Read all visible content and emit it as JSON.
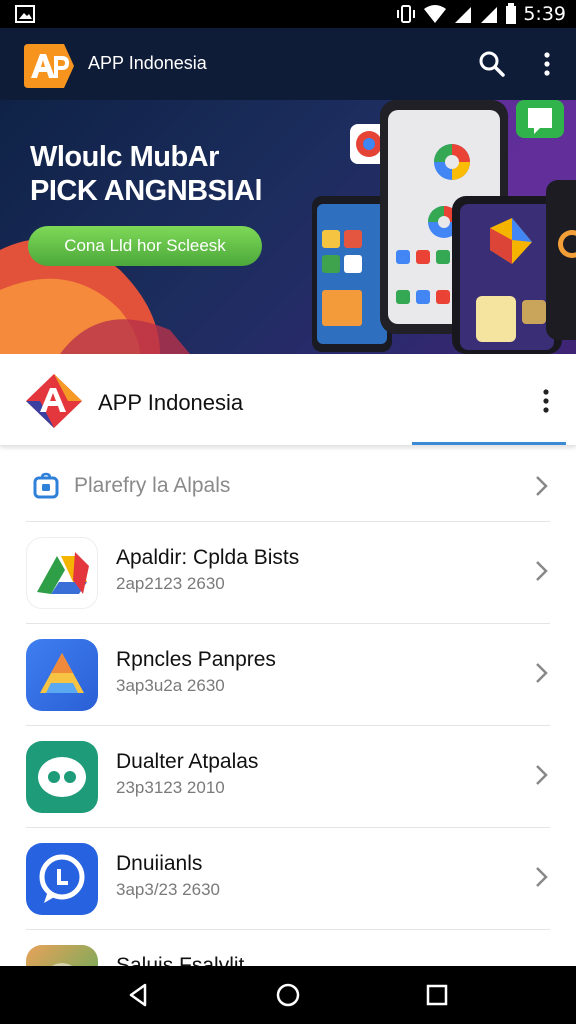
{
  "status_bar": {
    "time": "5:39"
  },
  "app_bar": {
    "title": "APP Indonesia",
    "logo_text": "A"
  },
  "banner": {
    "headline_1": "Wloulc MubAr",
    "headline_2": "PICK ANGNBSIAl",
    "cta_label": "Cona Lld hor Scleesk"
  },
  "brand_header": {
    "title": "APP Indonesia"
  },
  "section": {
    "label": "Plarefry la Alpals"
  },
  "items": [
    {
      "title": "Apaldir: Cplda Bists",
      "subtitle": "2ap2123 2630"
    },
    {
      "title": "Rpncles Panpres",
      "subtitle": "3ap3u2a 2630"
    },
    {
      "title": "Dualter Atpalas",
      "subtitle": "23p3123 2010"
    },
    {
      "title": "Dnuiianls",
      "subtitle": "3ap3/23 2630"
    },
    {
      "title": "Saluis Fsalvlit",
      "subtitle": ""
    }
  ],
  "colors": {
    "app_bar": "#0f1c38",
    "brand_orange": "#f7941d",
    "cta_green": "#5cbf45",
    "accent_blue": "#3a8ad6"
  }
}
